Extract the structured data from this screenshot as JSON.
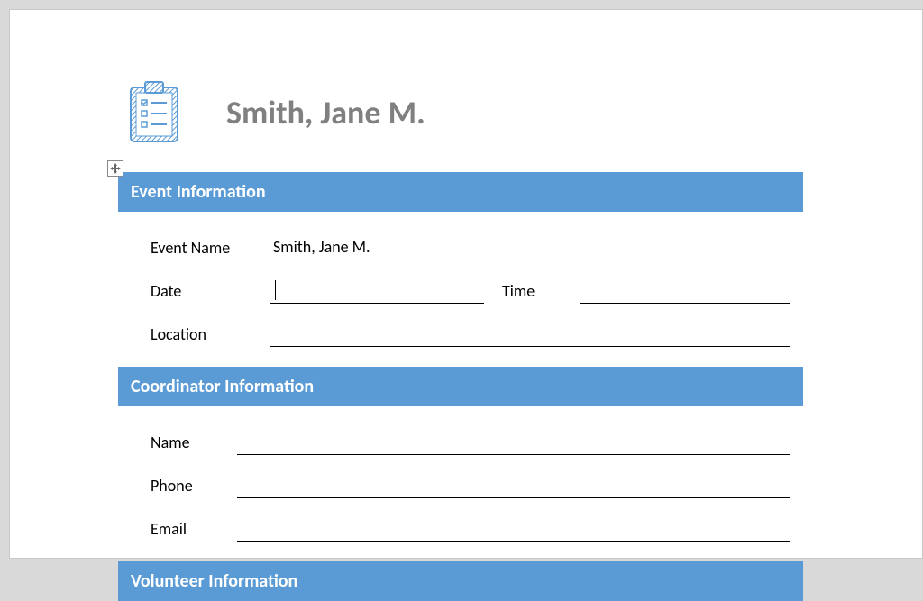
{
  "header": {
    "title": "Smith, Jane M."
  },
  "sections": {
    "event_info": {
      "heading": "Event Information",
      "fields": {
        "event_name": {
          "label": "Event Name",
          "value": "Smith, Jane M."
        },
        "date": {
          "label": "Date",
          "value": ""
        },
        "time": {
          "label": "Time",
          "value": ""
        },
        "location": {
          "label": "Location",
          "value": ""
        }
      }
    },
    "coordinator_info": {
      "heading": "Coordinator Information",
      "fields": {
        "name": {
          "label": "Name",
          "value": ""
        },
        "phone": {
          "label": "Phone",
          "value": ""
        },
        "email": {
          "label": "Email",
          "value": ""
        }
      }
    },
    "volunteer_info": {
      "heading": "Volunteer Information"
    }
  }
}
